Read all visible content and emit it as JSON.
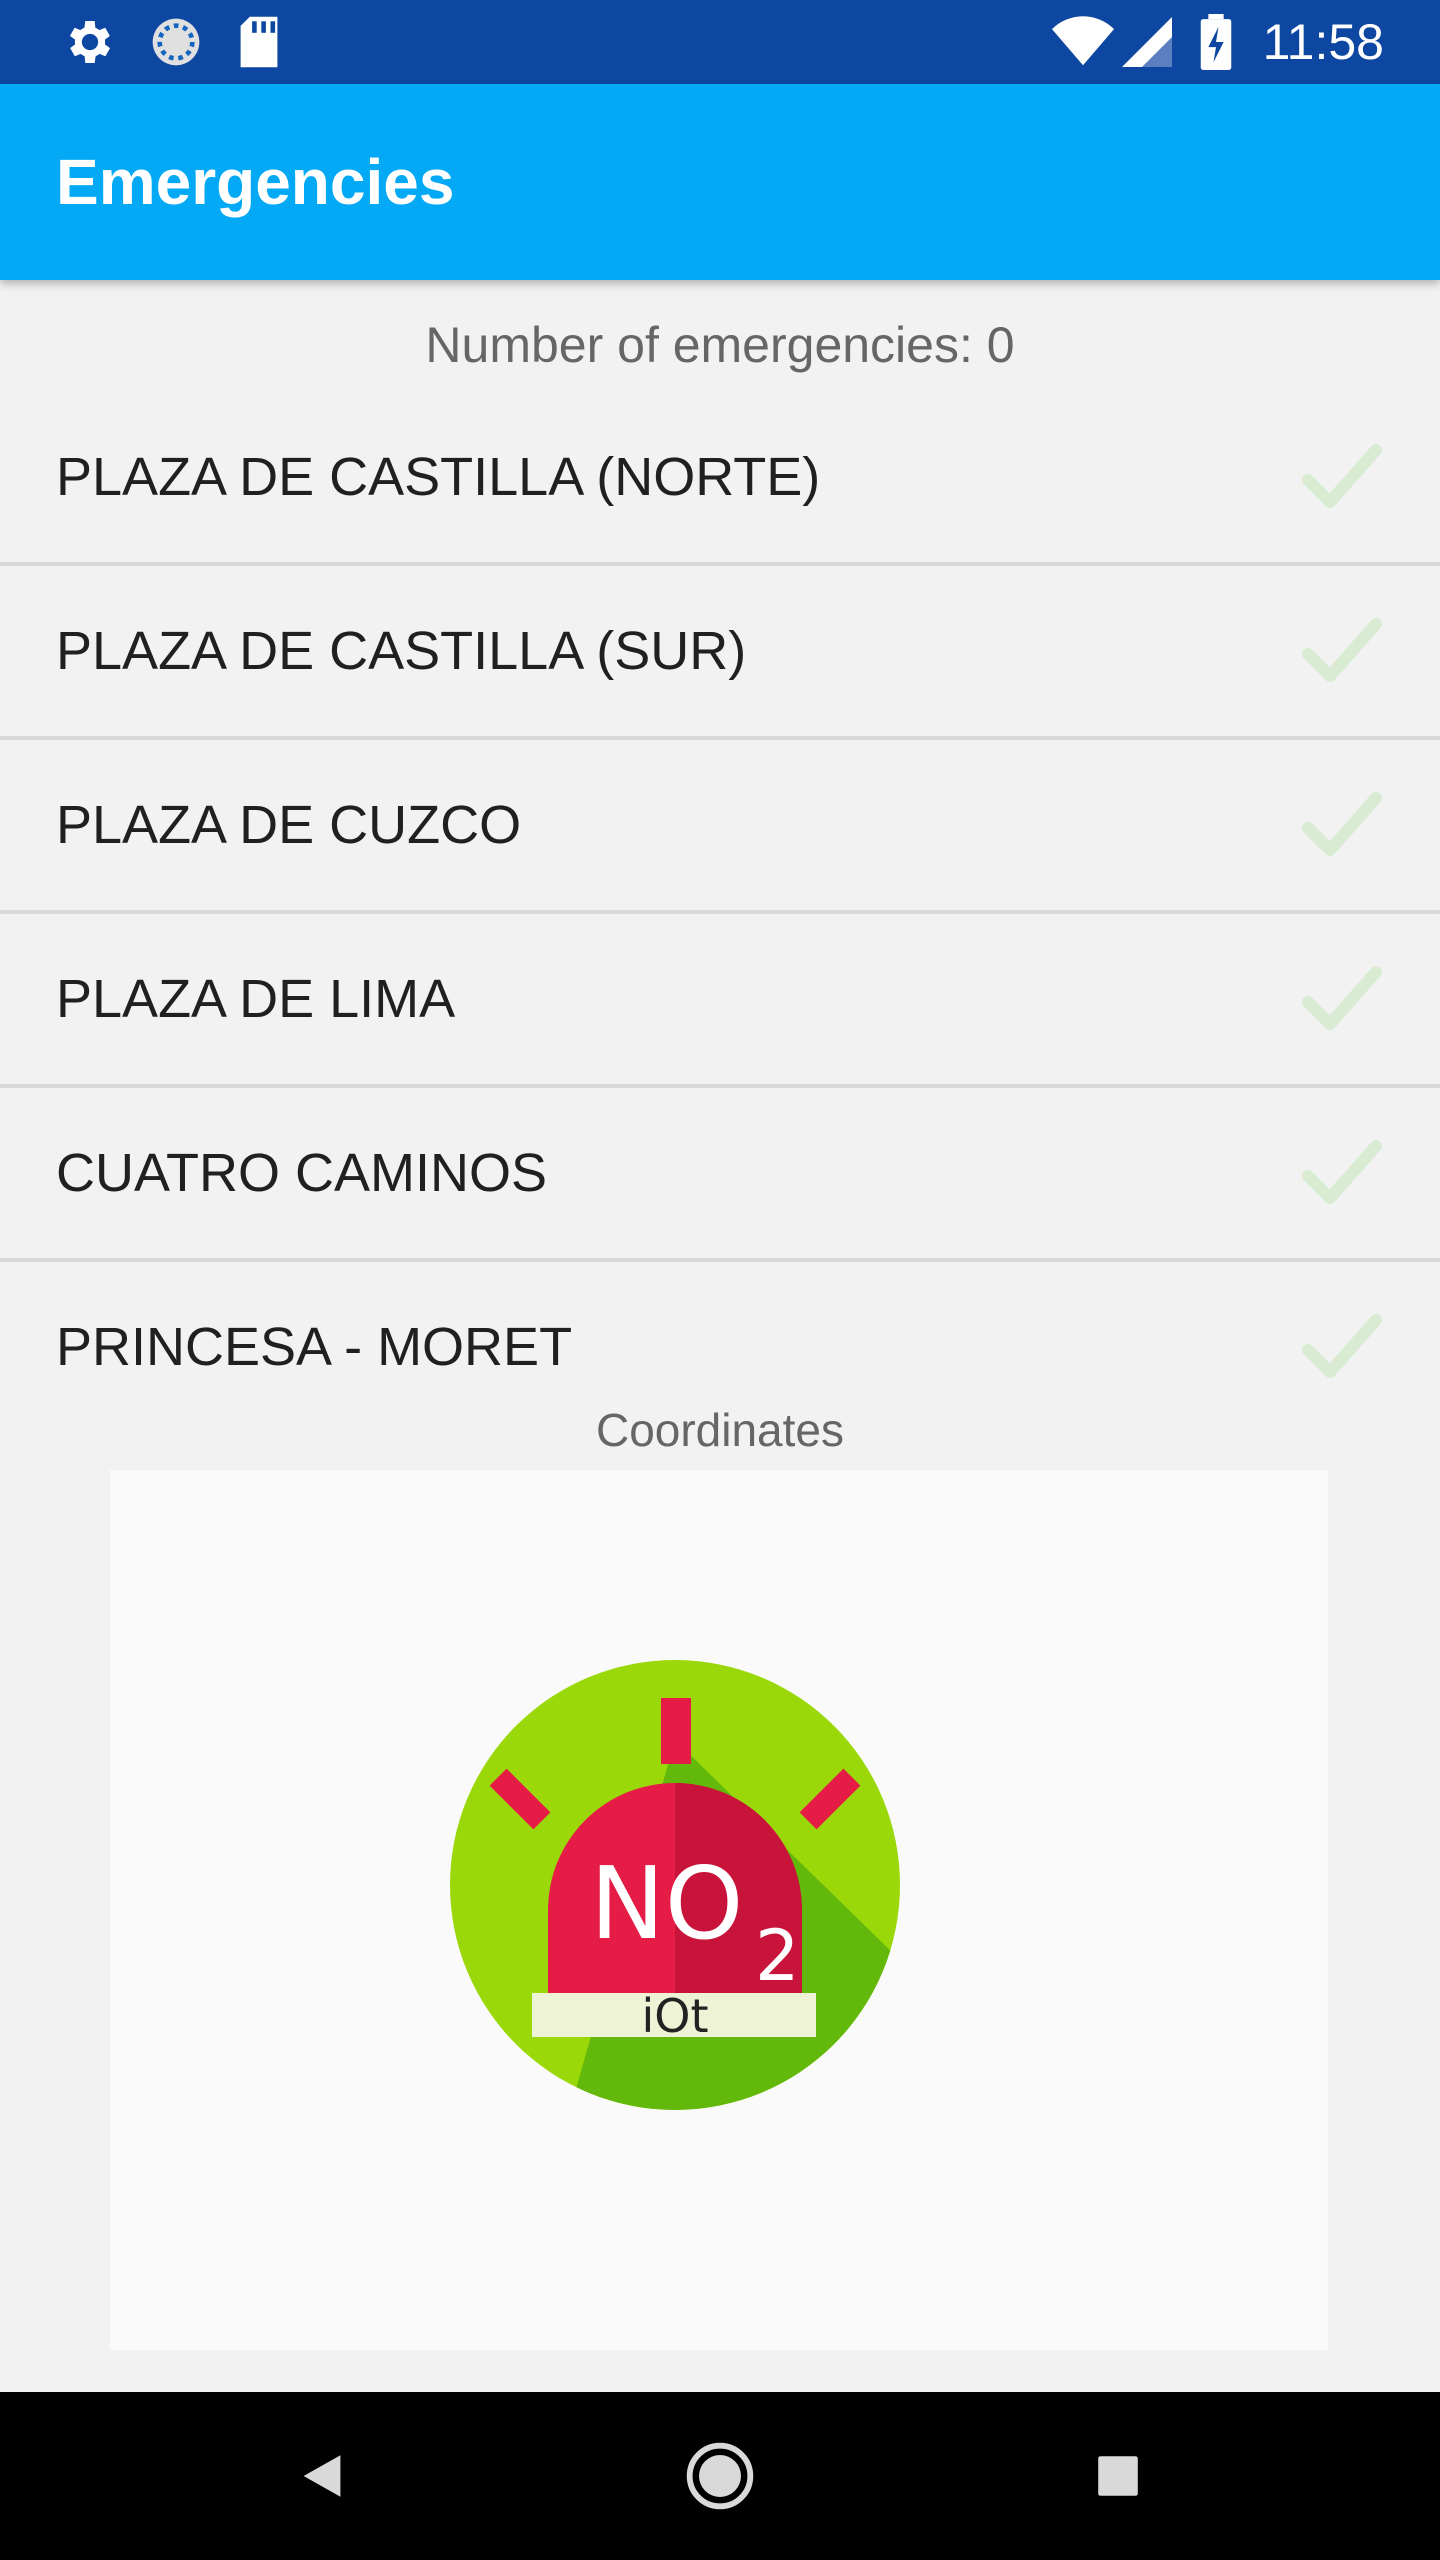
{
  "status_bar": {
    "time": "11:58",
    "icons": [
      "gear-icon",
      "sync-icon",
      "sd-card-icon",
      "wifi-icon",
      "signal-icon",
      "battery-charging-icon"
    ]
  },
  "app_bar": {
    "title": "Emergencies"
  },
  "main": {
    "count_text": "Number of emergencies: 0",
    "stations": [
      {
        "label": "PLAZA DE CASTILLA (NORTE)",
        "icon": "check-icon"
      },
      {
        "label": "PLAZA DE CASTILLA (SUR)",
        "icon": "check-icon"
      },
      {
        "label": "PLAZA DE CUZCO",
        "icon": "check-icon"
      },
      {
        "label": "PLAZA DE LIMA",
        "icon": "check-icon"
      },
      {
        "label": "CUATRO CAMINOS",
        "icon": "check-icon"
      },
      {
        "label": "PRINCESA - MORET",
        "icon": "check-icon"
      }
    ],
    "coordinates_label": "Coordinates",
    "logo": {
      "text_main": "NO",
      "text_sub": "2",
      "text_band": "iOt"
    }
  },
  "colors": {
    "status_bar": "#0d47a1",
    "app_bar": "#03a9f4",
    "check": "#c8e6c9",
    "logo_green": "#8bc80a",
    "logo_red": "#e01a3c"
  },
  "nav_bar": {
    "icons": [
      "back-icon",
      "home-icon",
      "recents-icon"
    ]
  }
}
